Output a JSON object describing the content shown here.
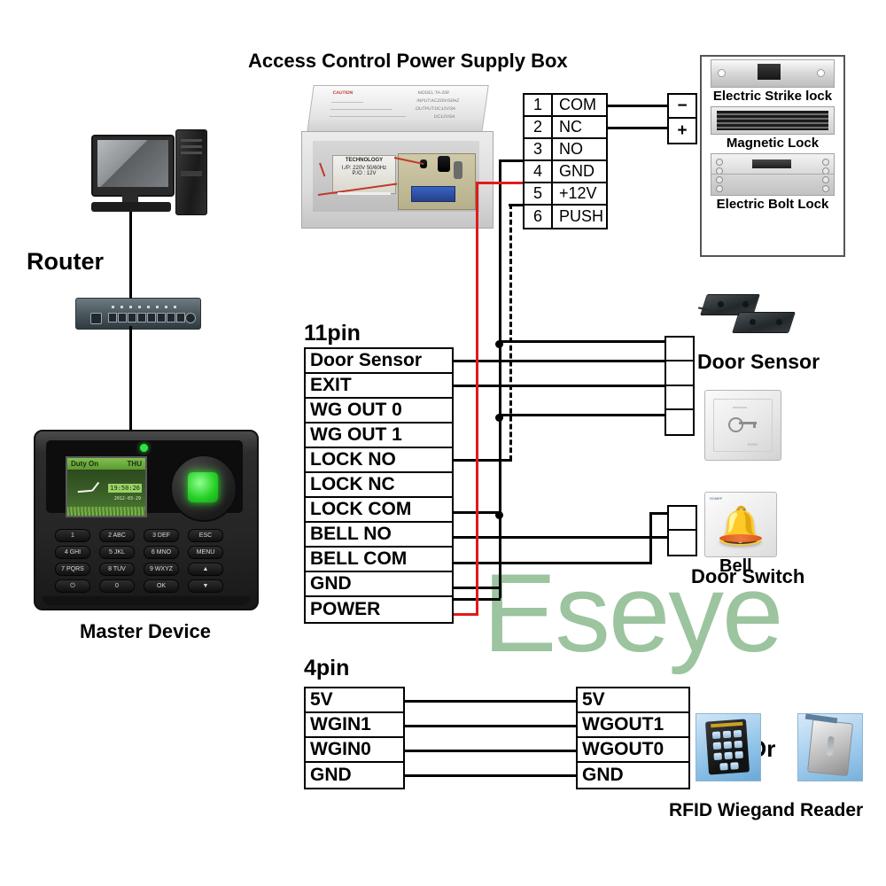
{
  "diagram": {
    "title_power_supply": "Access Control Power Supply Box",
    "watermark": "Eseye"
  },
  "power_supply": {
    "photo_caption_caution": "CAUTION",
    "photo_spec_model": "MODEL:TA-208",
    "photo_spec_input": "INPUT:AC220V/50HZ",
    "photo_spec_output": "OUTPUT:DC12V/3A",
    "photo_spec_output2": "DC12V/5A",
    "transformer_label": "TECHNOLOGY",
    "transformer_sub1": "I./P: 220V  50/60Hz",
    "transformer_sub2": "P./O :  12V",
    "terminals": [
      {
        "num": "1",
        "label": "COM"
      },
      {
        "num": "2",
        "label": "NC"
      },
      {
        "num": "3",
        "label": "NO"
      },
      {
        "num": "4",
        "label": "GND"
      },
      {
        "num": "5",
        "label": "+12V"
      },
      {
        "num": "6",
        "label": "PUSH"
      }
    ]
  },
  "lock_panel": {
    "items": [
      {
        "caption": "Electric Strike lock"
      },
      {
        "caption": "Magnetic Lock"
      },
      {
        "caption": "Electric Bolt Lock"
      }
    ],
    "connector": {
      "minus": "−",
      "plus": "+"
    }
  },
  "pin11": {
    "heading": "11pin",
    "rows": [
      {
        "label": "Door Sensor"
      },
      {
        "label": "EXIT"
      },
      {
        "label": "WG OUT 0"
      },
      {
        "label": "WG OUT 1"
      },
      {
        "label": "LOCK NO"
      },
      {
        "label": "LOCK NC"
      },
      {
        "label": "LOCK COM"
      },
      {
        "label": "BELL NO"
      },
      {
        "label": "BELL COM"
      },
      {
        "label": "GND"
      },
      {
        "label": "POWER"
      }
    ]
  },
  "pin4": {
    "heading": "4pin",
    "left_rows": [
      {
        "label": "5V"
      },
      {
        "label": "WGIN1"
      },
      {
        "label": "WGIN0"
      },
      {
        "label": "GND"
      }
    ],
    "right_rows": [
      {
        "label": "5V"
      },
      {
        "label": "WGOUT1"
      },
      {
        "label": "WGOUT0"
      },
      {
        "label": "GND"
      }
    ]
  },
  "peripherals": {
    "door_sensor": "Door Sensor",
    "door_switch": "Door Switch",
    "bell": "Bell",
    "rfid_reader": "RFID Wiegand Reader",
    "or": "Or"
  },
  "network": {
    "router_label": "Router",
    "master_label": "Master Device"
  },
  "master_device": {
    "screen_status": "Duty On",
    "screen_day": "THU",
    "screen_time": "19:50:26",
    "screen_date": "2012-03-29",
    "keys": [
      "1",
      "2 ABC",
      "3 DEF",
      "ESC",
      "4 GHI",
      "5 JKL",
      "6 MNO",
      "MENU",
      "7 PQRS",
      "8 TUV",
      "9 WXYZ",
      "▲",
      "⏻",
      "0",
      "OK",
      "▼"
    ]
  },
  "colors": {
    "wire_power": "#e11b1b",
    "wire_signal": "#000000",
    "watermark": "#9cc49f",
    "accent_green": "#2ddf2d"
  }
}
